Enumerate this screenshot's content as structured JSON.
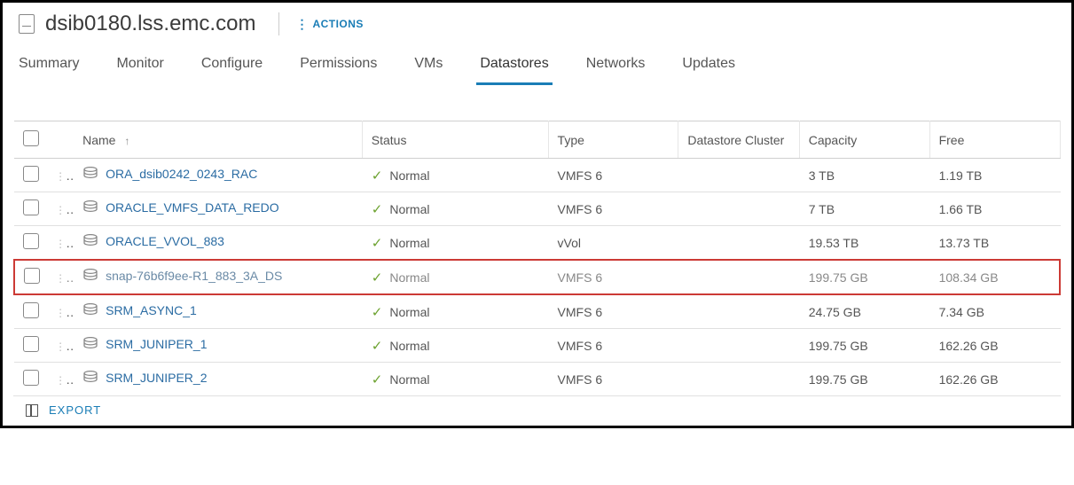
{
  "header": {
    "title": "dsib0180.lss.emc.com",
    "actions_label": "ACTIONS"
  },
  "tabs": [
    {
      "label": "Summary"
    },
    {
      "label": "Monitor"
    },
    {
      "label": "Configure"
    },
    {
      "label": "Permissions"
    },
    {
      "label": "VMs"
    },
    {
      "label": "Datastores",
      "active": true
    },
    {
      "label": "Networks"
    },
    {
      "label": "Updates"
    }
  ],
  "table": {
    "columns": {
      "name": "Name",
      "status": "Status",
      "type": "Type",
      "cluster": "Datastore Cluster",
      "capacity": "Capacity",
      "free": "Free"
    },
    "rows": [
      {
        "name": "ORA_dsib0242_0243_RAC",
        "status": "Normal",
        "type": "VMFS 6",
        "cluster": "",
        "capacity": "3 TB",
        "free": "1.19 TB",
        "highlight": false
      },
      {
        "name": "ORACLE_VMFS_DATA_REDO",
        "status": "Normal",
        "type": "VMFS 6",
        "cluster": "",
        "capacity": "7 TB",
        "free": "1.66 TB",
        "highlight": false
      },
      {
        "name": "ORACLE_VVOL_883",
        "status": "Normal",
        "type": "vVol",
        "cluster": "",
        "capacity": "19.53 TB",
        "free": "13.73 TB",
        "highlight": false
      },
      {
        "name": "snap-76b6f9ee-R1_883_3A_DS",
        "status": "Normal",
        "type": "VMFS 6",
        "cluster": "",
        "capacity": "199.75 GB",
        "free": "108.34 GB",
        "highlight": true
      },
      {
        "name": "SRM_ASYNC_1",
        "status": "Normal",
        "type": "VMFS 6",
        "cluster": "",
        "capacity": "24.75 GB",
        "free": "7.34 GB",
        "highlight": false
      },
      {
        "name": "SRM_JUNIPER_1",
        "status": "Normal",
        "type": "VMFS 6",
        "cluster": "",
        "capacity": "199.75 GB",
        "free": "162.26 GB",
        "highlight": false
      },
      {
        "name": "SRM_JUNIPER_2",
        "status": "Normal",
        "type": "VMFS 6",
        "cluster": "",
        "capacity": "199.75 GB",
        "free": "162.26 GB",
        "highlight": false
      }
    ]
  },
  "footer": {
    "export_label": "EXPORT"
  }
}
